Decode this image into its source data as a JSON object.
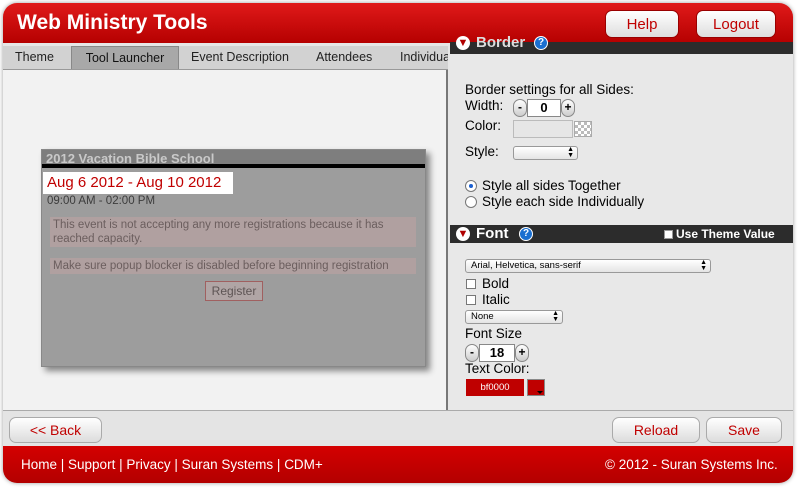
{
  "header": {
    "title": "Web Ministry Tools",
    "help_label": "Help",
    "logout_label": "Logout"
  },
  "tabs": [
    {
      "label": "Theme"
    },
    {
      "label": "Tool Launcher"
    },
    {
      "label": "Event Description"
    },
    {
      "label": "Attendees"
    },
    {
      "label": "Individua"
    }
  ],
  "preview": {
    "event_title": "2012 Vacation Bible School",
    "event_dates": "Aug 6 2012 - Aug 10 2012",
    "event_time": "09:00 AM - 02:00 PM",
    "message_capacity": "This event is not accepting any more registrations because it has reached capacity.",
    "message_popup": "Make sure popup blocker is disabled before beginning registration",
    "register_label": "Register"
  },
  "border_section": {
    "title": "Border",
    "all_sides_label": "Border settings for all Sides:",
    "width_label": "Width:",
    "width_value": "0",
    "color_label": "Color:",
    "style_label": "Style:",
    "style_value": "",
    "radio_together": "Style all sides Together",
    "radio_individual": "Style each side Individually"
  },
  "font_section": {
    "title": "Font",
    "use_theme_label": "Use Theme Value",
    "family_value": "Arial, Helvetica, sans-serif",
    "bold_label": "Bold",
    "italic_label": "Italic",
    "decoration_value": "None",
    "size_label": "Font Size",
    "size_value": "18",
    "text_color_label": "Text Color:",
    "text_color_value": "bf0000"
  },
  "colors": {
    "brand_red": "#c00000",
    "text_color": "#bf0000"
  },
  "actions": {
    "back_label": "<< Back",
    "reload_label": "Reload",
    "save_label": "Save"
  },
  "footer": {
    "links": [
      "Home",
      "Support",
      "Privacy",
      "Suran Systems",
      "CDM+"
    ],
    "copyright": "© 2012 - Suran Systems Inc."
  }
}
